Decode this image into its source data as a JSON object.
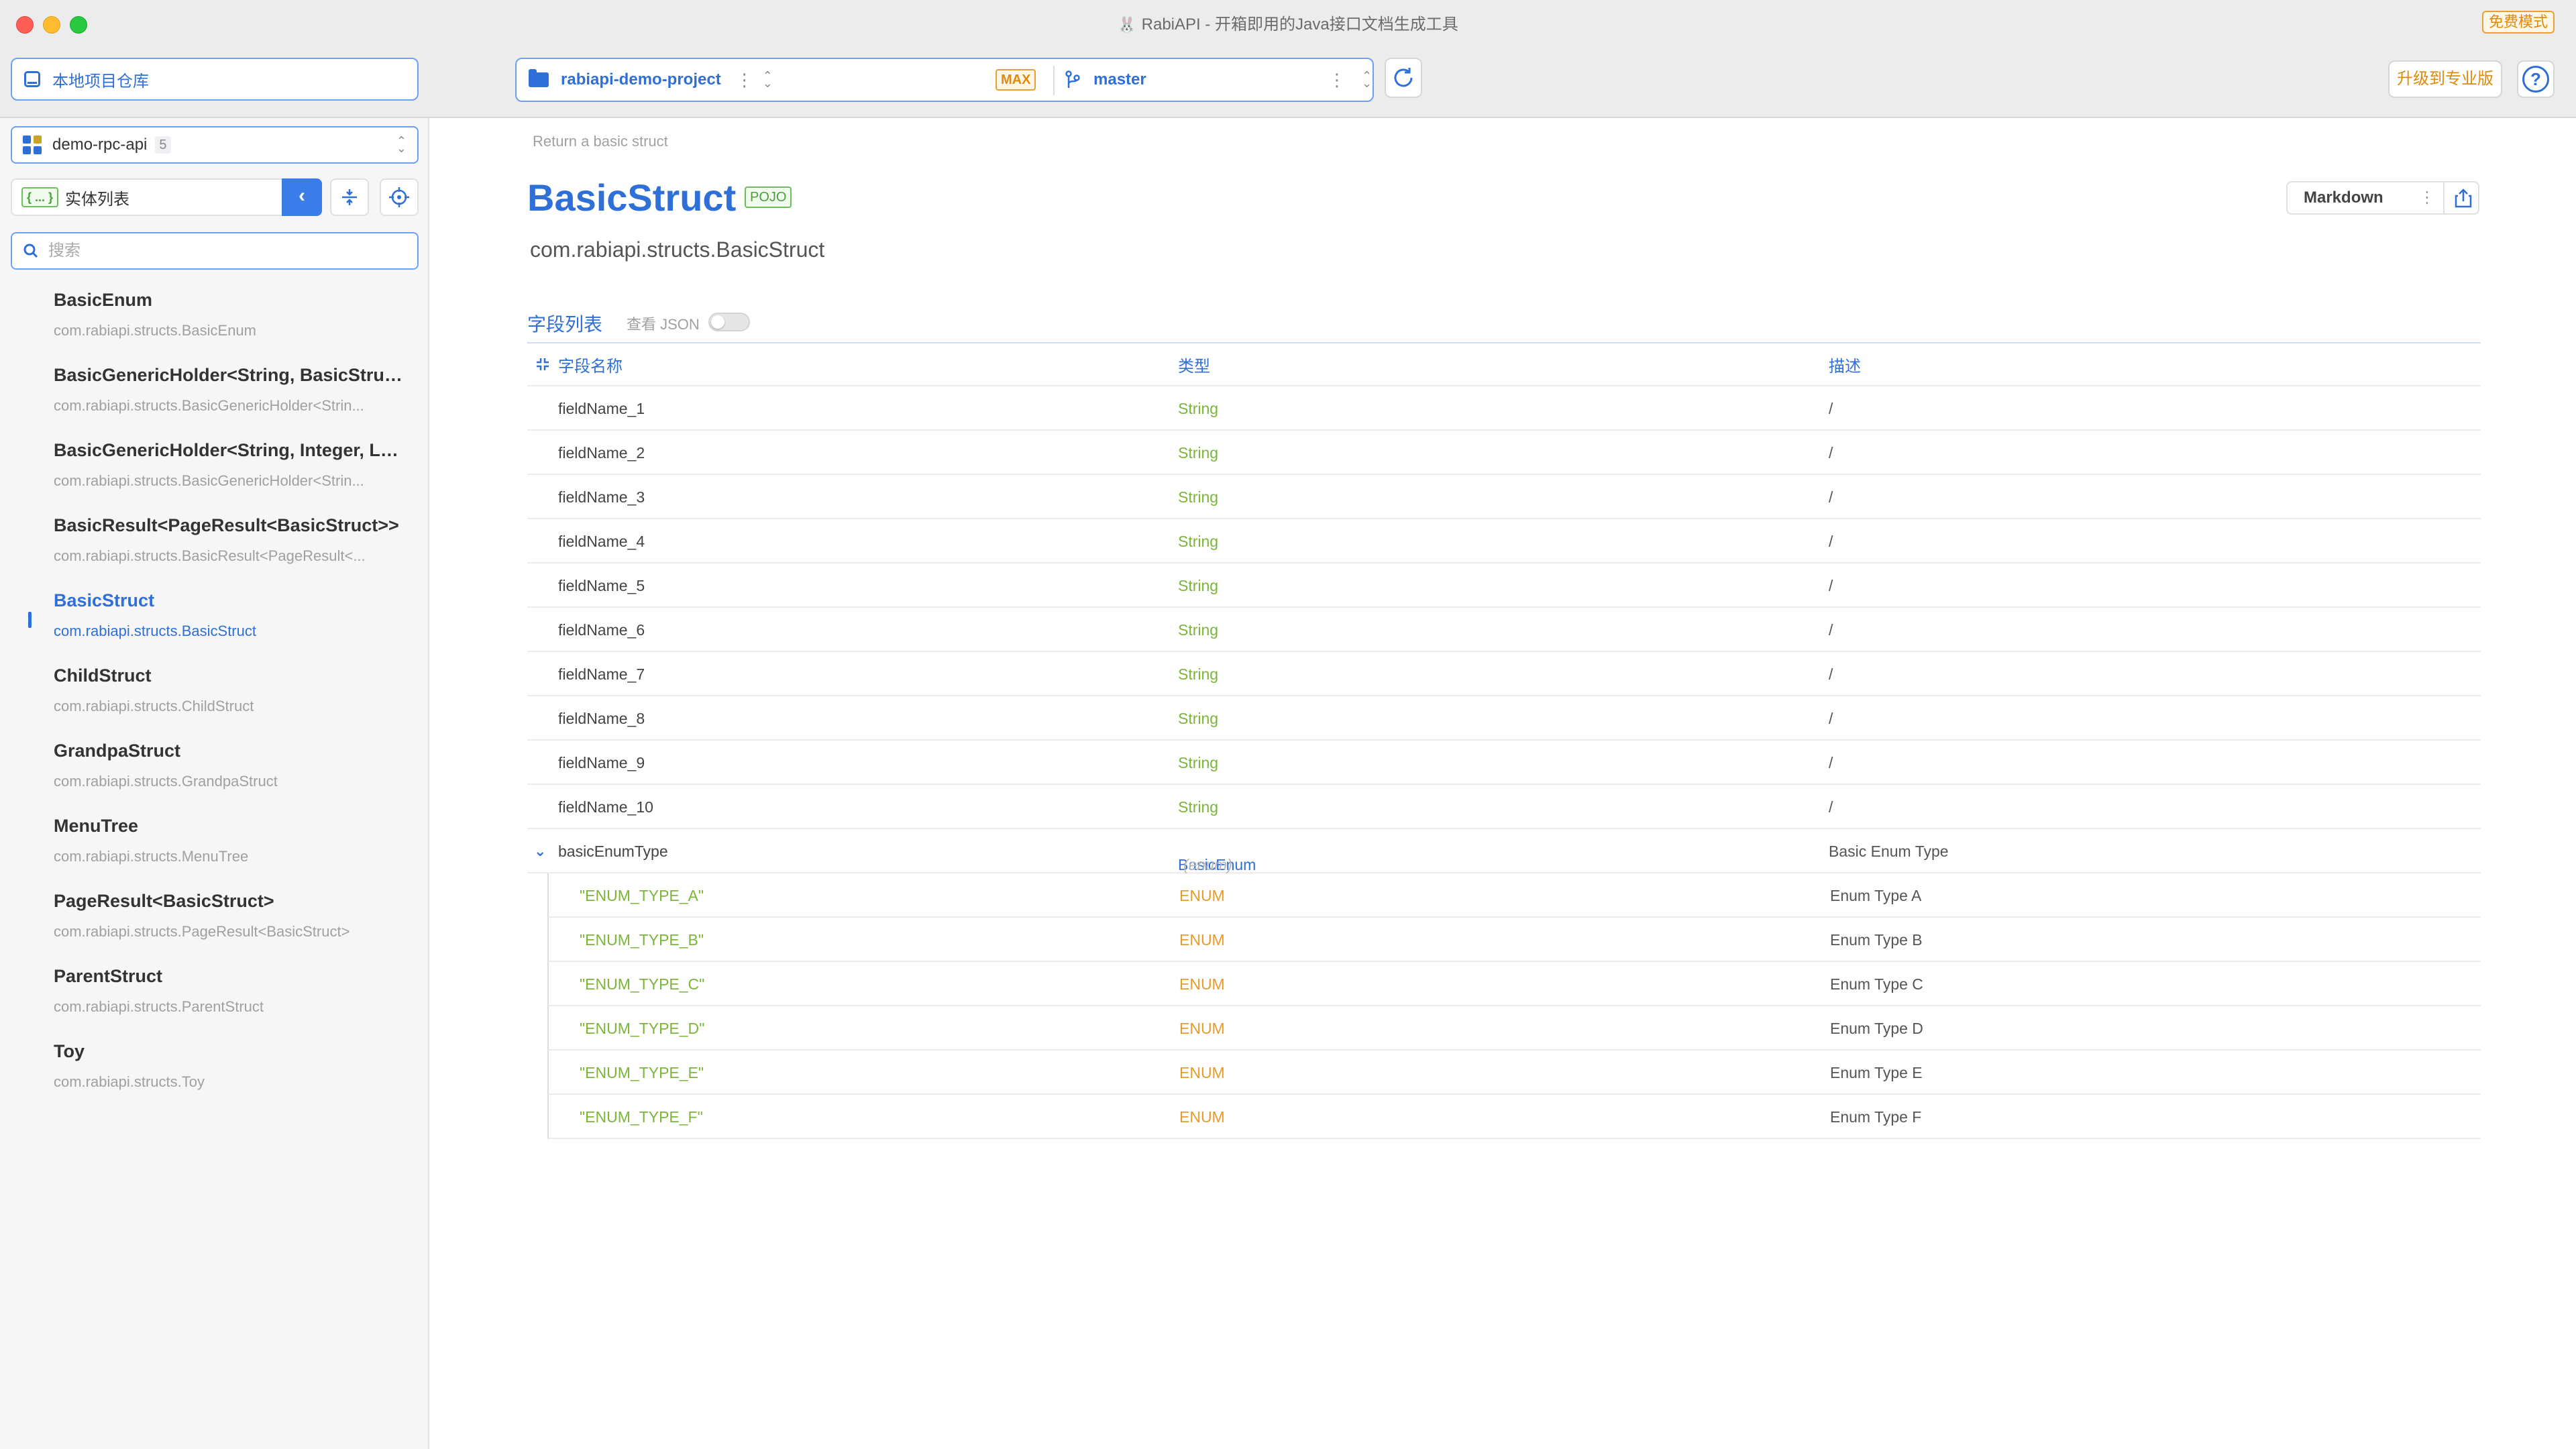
{
  "window": {
    "title": "RabiAPI - 开箱即用的Java接口文档生成工具",
    "free_badge": "免费模式"
  },
  "toolbar": {
    "repo_label": "本地项目仓库",
    "project_name": "rabiapi-demo-project",
    "max_badge": "MAX",
    "branch": "master",
    "upgrade_label": "升级到专业版",
    "help_label": "?"
  },
  "sidebar": {
    "module_name": "demo-rpc-api",
    "module_count": "5",
    "entity_label": "实体列表",
    "entity_badge": "{ ... }",
    "search_placeholder": "搜索",
    "items": [
      {
        "name": "BasicEnum",
        "pkg": "com.rabiapi.structs.BasicEnum"
      },
      {
        "name": "BasicGenericHolder<String, BasicStruc...",
        "pkg": "com.rabiapi.structs.BasicGenericHolder<Strin..."
      },
      {
        "name": "BasicGenericHolder<String, Integer, Lo...",
        "pkg": "com.rabiapi.structs.BasicGenericHolder<Strin..."
      },
      {
        "name": "BasicResult<PageResult<BasicStruct>>",
        "pkg": "com.rabiapi.structs.BasicResult<PageResult<..."
      },
      {
        "name": "BasicStruct",
        "pkg": "com.rabiapi.structs.BasicStruct",
        "active": true
      },
      {
        "name": "ChildStruct",
        "pkg": "com.rabiapi.structs.ChildStruct"
      },
      {
        "name": "GrandpaStruct",
        "pkg": "com.rabiapi.structs.GrandpaStruct"
      },
      {
        "name": "MenuTree",
        "pkg": "com.rabiapi.structs.MenuTree"
      },
      {
        "name": "PageResult<BasicStruct>",
        "pkg": "com.rabiapi.structs.PageResult<BasicStruct>"
      },
      {
        "name": "ParentStruct",
        "pkg": "com.rabiapi.structs.ParentStruct"
      },
      {
        "name": "Toy",
        "pkg": "com.rabiapi.structs.Toy"
      }
    ]
  },
  "main": {
    "breadcrumb": "Return a basic struct",
    "title": "BasicStruct",
    "title_badge": "POJO",
    "class_path": "com.rabiapi.structs.BasicStruct",
    "export_format": "Markdown",
    "section_title": "字段列表",
    "json_toggle_label": "查看 JSON",
    "json_toggle_on": false,
    "columns": {
      "name": "字段名称",
      "type": "类型",
      "desc": "描述"
    },
    "fields": [
      {
        "name": "fieldName_1",
        "type": "String",
        "desc": "/"
      },
      {
        "name": "fieldName_2",
        "type": "String",
        "desc": "/"
      },
      {
        "name": "fieldName_3",
        "type": "String",
        "desc": "/"
      },
      {
        "name": "fieldName_4",
        "type": "String",
        "desc": "/"
      },
      {
        "name": "fieldName_5",
        "type": "String",
        "desc": "/"
      },
      {
        "name": "fieldName_6",
        "type": "String",
        "desc": "/"
      },
      {
        "name": "fieldName_7",
        "type": "String",
        "desc": "/"
      },
      {
        "name": "fieldName_8",
        "type": "String",
        "desc": "/"
      },
      {
        "name": "fieldName_9",
        "type": "String",
        "desc": "/"
      },
      {
        "name": "fieldName_10",
        "type": "String",
        "desc": "/"
      }
    ],
    "enum_field": {
      "name": "basicEnumType",
      "type": "BasicEnum",
      "type_hint": "(enum)",
      "desc": "Basic Enum Type",
      "values": [
        {
          "name": "\"ENUM_TYPE_A\"",
          "type": "ENUM",
          "desc": "Enum Type A"
        },
        {
          "name": "\"ENUM_TYPE_B\"",
          "type": "ENUM",
          "desc": "Enum Type B"
        },
        {
          "name": "\"ENUM_TYPE_C\"",
          "type": "ENUM",
          "desc": "Enum Type C"
        },
        {
          "name": "\"ENUM_TYPE_D\"",
          "type": "ENUM",
          "desc": "Enum Type D"
        },
        {
          "name": "\"ENUM_TYPE_E\"",
          "type": "ENUM",
          "desc": "Enum Type E"
        },
        {
          "name": "\"ENUM_TYPE_F\"",
          "type": "ENUM",
          "desc": "Enum Type F"
        }
      ]
    }
  },
  "colors": {
    "accent": "#2f6fd8",
    "type_string": "#7bb53a",
    "type_enum": "#e69b2a",
    "badge_orange": "#e08a0c",
    "badge_green": "#4a9f3a"
  }
}
